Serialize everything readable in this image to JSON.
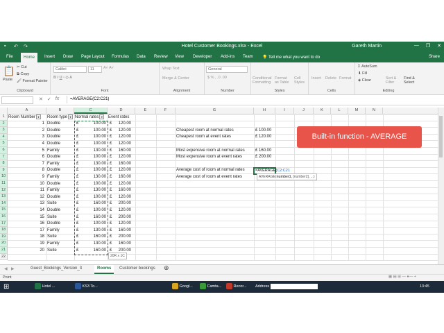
{
  "window": {
    "title": "Hotel Customer Bookings.xlsx - Excel",
    "user": "Gareth Martin",
    "share": "Share"
  },
  "tabs": [
    "File",
    "Home",
    "Insert",
    "Draw",
    "Page Layout",
    "Formulas",
    "Data",
    "Review",
    "View",
    "Developer",
    "Add-ins",
    "Team"
  ],
  "tell_me": "Tell me what you want to do",
  "ribbon": {
    "paste": "Paste",
    "cut": "Cut",
    "copy": "Copy",
    "format_painter": "Format Painter",
    "font_name": "Calibri",
    "font_size": "11",
    "wrap_text": "Wrap Text",
    "merge_center": "Merge & Center",
    "number_format": "General",
    "conditional": "Conditional Formatting",
    "format_as_table": "Format as Table",
    "cell_styles": "Cell Styles",
    "insert": "Insert",
    "delete": "Delete",
    "format": "Format",
    "autosum": "AutoSum",
    "fill": "Fill",
    "clear": "Clear",
    "sort_filter": "Sort & Filter",
    "find_select": "Find & Select",
    "groups": [
      "Clipboard",
      "Font",
      "Alignment",
      "Number",
      "Styles",
      "Cells",
      "Editing"
    ]
  },
  "formula_bar": {
    "name_box": "",
    "formula": "=AVERAGE(C2:C21)"
  },
  "columns": [
    "A",
    "B",
    "C",
    "D",
    "E",
    "F",
    "G",
    "H",
    "I",
    "J",
    "K",
    "L",
    "M",
    "N"
  ],
  "headers": {
    "a": "Room Number",
    "b": "Room type",
    "c": "Normal rates",
    "d": "Event rates"
  },
  "currency": "£",
  "rows": [
    {
      "n": "1",
      "t": "Double",
      "c": "100.00",
      "d": "120.00"
    },
    {
      "n": "2",
      "t": "Double",
      "c": "100.00",
      "d": "120.00"
    },
    {
      "n": "3",
      "t": "Double",
      "c": "100.00",
      "d": "120.00"
    },
    {
      "n": "4",
      "t": "Double",
      "c": "100.00",
      "d": "120.00"
    },
    {
      "n": "5",
      "t": "Family",
      "c": "130.00",
      "d": "160.00"
    },
    {
      "n": "6",
      "t": "Double",
      "c": "100.00",
      "d": "120.00"
    },
    {
      "n": "7",
      "t": "Family",
      "c": "130.00",
      "d": "160.00"
    },
    {
      "n": "8",
      "t": "Double",
      "c": "100.00",
      "d": "120.00"
    },
    {
      "n": "9",
      "t": "Family",
      "c": "130.00",
      "d": "160.00"
    },
    {
      "n": "10",
      "t": "Double",
      "c": "100.00",
      "d": "120.00"
    },
    {
      "n": "11",
      "t": "Family",
      "c": "130.00",
      "d": "160.00"
    },
    {
      "n": "12",
      "t": "Double",
      "c": "100.00",
      "d": "120.00"
    },
    {
      "n": "13",
      "t": "Suite",
      "c": "160.00",
      "d": "200.00"
    },
    {
      "n": "14",
      "t": "Double",
      "c": "100.00",
      "d": "120.00"
    },
    {
      "n": "15",
      "t": "Suite",
      "c": "160.00",
      "d": "200.00"
    },
    {
      "n": "16",
      "t": "Double",
      "c": "100.00",
      "d": "120.00"
    },
    {
      "n": "17",
      "t": "Family",
      "c": "130.00",
      "d": "160.00"
    },
    {
      "n": "18",
      "t": "Suite",
      "c": "160.00",
      "d": "200.00"
    },
    {
      "n": "19",
      "t": "Family",
      "c": "130.00",
      "d": "160.00"
    },
    {
      "n": "20",
      "t": "Suite",
      "c": "160.00",
      "d": "200.00"
    }
  ],
  "summary": [
    {
      "label": "Cheapest room at normal rates",
      "value": "£ 100.00"
    },
    {
      "label": "Cheapest room at event rates",
      "value": "£ 120.00"
    },
    {
      "label": "Most expensive room at normal rates",
      "value": "£ 160.00"
    },
    {
      "label": "Most expensive room at event rates",
      "value": "£ 200.00"
    },
    {
      "label": "Average cost of room at normal rates",
      "value_prefix": "=AVERAGE(",
      "value_ref": "C2:C21"
    },
    {
      "label": "Average cost of room at event rates",
      "value": ""
    }
  ],
  "callout": "Built-in function - AVERAGE",
  "tooltip": {
    "fn": "AVERAGE(",
    "arg1": "number1",
    "rest": ", [number2], ...)"
  },
  "size_badge": "20R x 1C",
  "sheets": [
    "Guest_Bookings_Version_3",
    "Rooms",
    "Customer bookings"
  ],
  "status": "Point",
  "taskbar": {
    "items": [
      "Hotel ...",
      "KS3 To...",
      "Googl...",
      "Camta...",
      "Recor..."
    ],
    "address_label": "Address",
    "time": "13:45"
  }
}
